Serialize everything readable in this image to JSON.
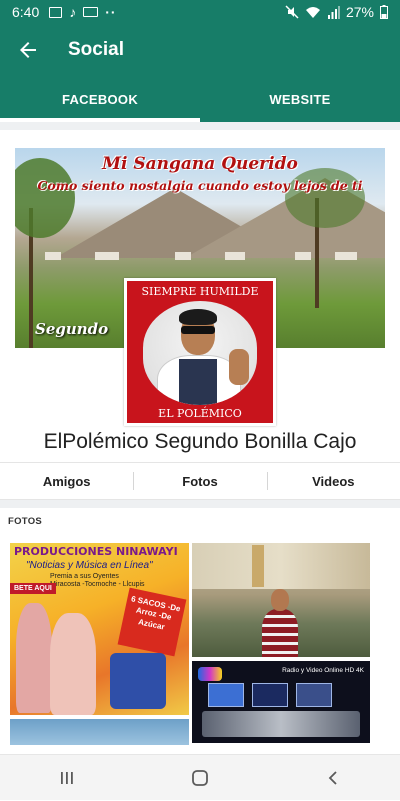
{
  "status_bar": {
    "time": "6:40",
    "battery": "27%",
    "overflow": "··"
  },
  "app_bar": {
    "title": "Social"
  },
  "tabs": [
    {
      "label": "FACEBOOK",
      "active": true
    },
    {
      "label": "WEBSITE",
      "active": false
    }
  ],
  "profile": {
    "cover_title": "Mi Sangana Querido",
    "cover_subtitle": "Como siento nostalgia cuando estoy lejos de ti",
    "cover_badge": "Segundo",
    "picture_top_text": "SIEMPRE HUMILDE",
    "picture_bottom_text": "EL POLÉMICO",
    "name": "ElPolémico Segundo Bonilla Cajo"
  },
  "segments": [
    {
      "label": "Amigos"
    },
    {
      "label": "Fotos"
    },
    {
      "label": "Videos"
    }
  ],
  "photos": {
    "section_label": "FOTOS",
    "photo1": {
      "title": "PRODUCCIONES NINAWAYI",
      "subtitle": "\"Noticias y Música en Línea\"",
      "line2": "Premia a sus Oyentes",
      "line3": "Miracosta -Tocmoche - Llcupis",
      "tag": "BETE AQUI",
      "badge": "6 SACOS -De Arroz -De Azúcar"
    },
    "photo3": {
      "label": "Radio y Video Online HD 4K"
    }
  },
  "colors": {
    "primary": "#177d68",
    "tab_indicator": "#ffffff",
    "profile_frame": "#c8141c"
  }
}
